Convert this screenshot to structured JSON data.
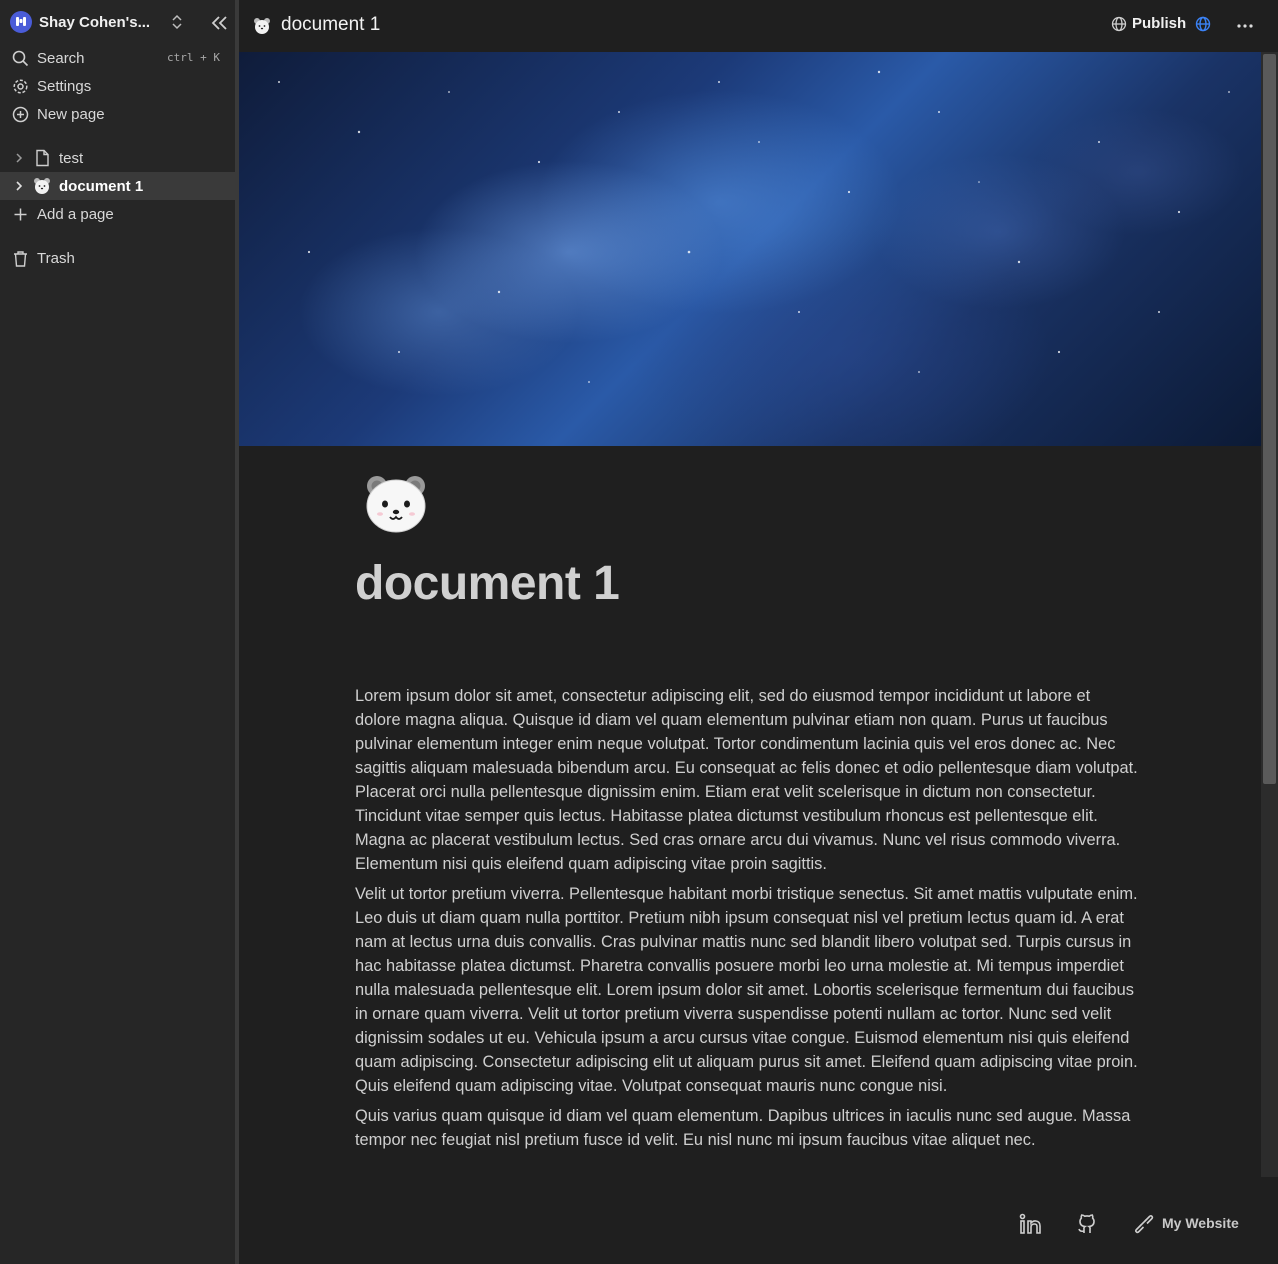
{
  "sidebar": {
    "workspace_name": "Shay Cohen's...",
    "nav": {
      "search_label": "Search",
      "search_shortcut": "ctrl + K",
      "settings_label": "Settings",
      "new_page_label": "New page"
    },
    "pages": [
      {
        "label": "test",
        "icon": "file-icon"
      },
      {
        "label": "document 1",
        "icon": "bear-emoji"
      }
    ],
    "add_page_label": "Add a page",
    "trash_label": "Trash"
  },
  "topbar": {
    "title": "document 1",
    "publish_label": "Publish"
  },
  "document": {
    "title": "document 1",
    "paragraphs": [
      "Lorem ipsum dolor sit amet, consectetur adipiscing elit, sed do eiusmod tempor incididunt ut labore et dolore magna aliqua. Quisque id diam vel quam elementum pulvinar etiam non quam. Purus ut faucibus pulvinar elementum integer enim neque volutpat. Tortor condimentum lacinia quis vel eros donec ac. Nec sagittis aliquam malesuada bibendum arcu. Eu consequat ac felis donec et odio pellentesque diam volutpat. Placerat orci nulla pellentesque dignissim enim. Etiam erat velit scelerisque in dictum non consectetur. Tincidunt vitae semper quis lectus. Habitasse platea dictumst vestibulum rhoncus est pellentesque elit. Magna ac placerat vestibulum lectus. Sed cras ornare arcu dui vivamus. Nunc vel risus commodo viverra. Elementum nisi quis eleifend quam adipiscing vitae proin sagittis.",
      "Velit ut tortor pretium viverra. Pellentesque habitant morbi tristique senectus. Sit amet mattis vulputate enim. Leo duis ut diam quam nulla porttitor. Pretium nibh ipsum consequat nisl vel pretium lectus quam id. A erat nam at lectus urna duis convallis. Cras pulvinar mattis nunc sed blandit libero volutpat sed. Turpis cursus in hac habitasse platea dictumst. Pharetra convallis posuere morbi leo urna molestie at. Mi tempus imperdiet nulla malesuada pellentesque elit. Lorem ipsum dolor sit amet. Lobortis scelerisque fermentum dui faucibus in ornare quam viverra. Velit ut tortor pretium viverra suspendisse potenti nullam ac tortor. Nunc sed velit dignissim sodales ut eu. Vehicula ipsum a arcu cursus vitae congue. Euismod elementum nisi quis eleifend quam adipiscing. Consectetur adipiscing elit ut aliquam purus sit amet. Eleifend quam adipiscing vitae proin. Quis eleifend quam adipiscing vitae. Volutpat consequat mauris nunc congue nisi.",
      "Quis varius quam quisque id diam vel quam elementum. Dapibus ultrices in iaculis nunc sed augue. Massa tempor nec feugiat nisl pretium fusce id velit. Eu nisl nunc mi ipsum faucibus vitae aliquet nec."
    ]
  },
  "footer": {
    "website_label": "My Website"
  },
  "colors": {
    "sidebar_bg": "#262626",
    "page_bg": "#1f1f1f",
    "active_item_bg": "#3a3a3a",
    "accent_blue": "#3b82f6"
  }
}
